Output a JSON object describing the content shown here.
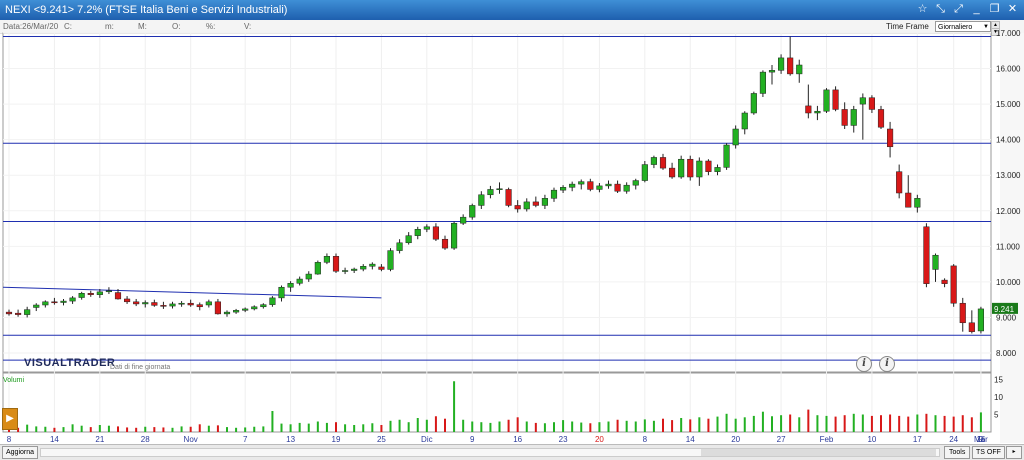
{
  "window": {
    "title": "NEXI <9.241> 7.2%  (FTSE Italia Beni e Servizi Industriali)"
  },
  "info_bar": {
    "date": "Data:26/Mar/20",
    "c": "C:",
    "m": "m:",
    "M": "M:",
    "o": "O:",
    "pct": "%:",
    "v": "V:"
  },
  "time_frame": {
    "label": "Time Frame",
    "value": "Giornaliero"
  },
  "brand": {
    "logo": "VISUALTRADER",
    "note": "Dati di fine giornata"
  },
  "volume_label": "Volumi",
  "buttons": {
    "aggiorna": "Aggiorna",
    "tools": "Tools",
    "ts_off": "TS OFF"
  },
  "colors": {
    "up": "#22b022",
    "down": "#d81818",
    "line": "#1f2fb0",
    "last_price_bg": "#1a7a1a"
  },
  "chart_data": [
    {
      "type": "candlestick",
      "ylim": [
        8.0,
        17.0
      ],
      "y_ticks": [
        "17.000",
        "16.000",
        "15.000",
        "14.000",
        "13.000",
        "12.000",
        "11.000",
        "10.000",
        "9.000",
        "8.000"
      ],
      "last_price_label": "9.241",
      "x_tick_labels": [
        "8",
        "14",
        "21",
        "28",
        "Nov",
        "7",
        "13",
        "19",
        "25",
        "Dic",
        "9",
        "16",
        "23",
        "20",
        "8",
        "14",
        "20",
        "27",
        "Feb",
        "10",
        "17",
        "24",
        "Mar",
        "9",
        "16"
      ],
      "horizontal_levels": [
        16.9,
        13.9,
        11.7,
        8.5,
        7.8
      ],
      "trendline": {
        "from": {
          "index": 0,
          "value": 9.85
        },
        "to": {
          "index": 41,
          "value": 9.55
        }
      },
      "ohlc": [
        [
          9.15,
          9.22,
          9.05,
          9.1
        ],
        [
          9.12,
          9.22,
          9.02,
          9.08
        ],
        [
          9.08,
          9.3,
          9.0,
          9.22
        ],
        [
          9.28,
          9.4,
          9.18,
          9.35
        ],
        [
          9.35,
          9.48,
          9.28,
          9.44
        ],
        [
          9.44,
          9.55,
          9.36,
          9.42
        ],
        [
          9.42,
          9.52,
          9.34,
          9.46
        ],
        [
          9.46,
          9.6,
          9.38,
          9.55
        ],
        [
          9.56,
          9.72,
          9.5,
          9.68
        ],
        [
          9.68,
          9.75,
          9.58,
          9.64
        ],
        [
          9.64,
          9.8,
          9.55,
          9.72
        ],
        [
          9.75,
          9.85,
          9.66,
          9.75
        ],
        [
          9.7,
          9.8,
          9.5,
          9.52
        ],
        [
          9.52,
          9.6,
          9.38,
          9.44
        ],
        [
          9.44,
          9.52,
          9.32,
          9.38
        ],
        [
          9.38,
          9.48,
          9.28,
          9.42
        ],
        [
          9.42,
          9.5,
          9.3,
          9.34
        ],
        [
          9.34,
          9.44,
          9.24,
          9.32
        ],
        [
          9.32,
          9.44,
          9.25,
          9.38
        ],
        [
          9.38,
          9.46,
          9.3,
          9.4
        ],
        [
          9.4,
          9.5,
          9.3,
          9.35
        ],
        [
          9.36,
          9.42,
          9.2,
          9.3
        ],
        [
          9.35,
          9.5,
          9.28,
          9.44
        ],
        [
          9.44,
          9.52,
          9.08,
          9.1
        ],
        [
          9.1,
          9.2,
          9.02,
          9.15
        ],
        [
          9.15,
          9.24,
          9.1,
          9.2
        ],
        [
          9.2,
          9.28,
          9.15,
          9.24
        ],
        [
          9.24,
          9.34,
          9.2,
          9.3
        ],
        [
          9.3,
          9.4,
          9.25,
          9.36
        ],
        [
          9.36,
          9.6,
          9.3,
          9.55
        ],
        [
          9.55,
          9.9,
          9.45,
          9.85
        ],
        [
          9.85,
          10.02,
          9.72,
          9.96
        ],
        [
          9.96,
          10.15,
          9.9,
          10.08
        ],
        [
          10.08,
          10.3,
          10.0,
          10.22
        ],
        [
          10.22,
          10.6,
          10.2,
          10.55
        ],
        [
          10.55,
          10.8,
          10.5,
          10.72
        ],
        [
          10.72,
          10.8,
          10.25,
          10.3
        ],
        [
          10.3,
          10.4,
          10.22,
          10.32
        ],
        [
          10.32,
          10.4,
          10.25,
          10.36
        ],
        [
          10.36,
          10.5,
          10.3,
          10.44
        ],
        [
          10.44,
          10.55,
          10.35,
          10.5
        ],
        [
          10.42,
          10.5,
          10.3,
          10.35
        ],
        [
          10.35,
          10.95,
          10.3,
          10.88
        ],
        [
          10.88,
          11.2,
          10.8,
          11.1
        ],
        [
          11.1,
          11.4,
          11.05,
          11.3
        ],
        [
          11.3,
          11.55,
          11.2,
          11.48
        ],
        [
          11.48,
          11.62,
          11.4,
          11.55
        ],
        [
          11.55,
          11.65,
          11.15,
          11.2
        ],
        [
          11.2,
          11.3,
          10.9,
          10.95
        ],
        [
          10.95,
          11.7,
          10.9,
          11.65
        ],
        [
          11.65,
          11.9,
          11.6,
          11.82
        ],
        [
          11.82,
          12.2,
          11.75,
          12.15
        ],
        [
          12.15,
          12.55,
          12.05,
          12.45
        ],
        [
          12.45,
          12.7,
          12.35,
          12.6
        ],
        [
          12.6,
          12.8,
          12.48,
          12.62
        ],
        [
          12.6,
          12.65,
          12.1,
          12.15
        ],
        [
          12.15,
          12.3,
          11.95,
          12.05
        ],
        [
          12.05,
          12.35,
          11.98,
          12.25
        ],
        [
          12.25,
          12.4,
          12.1,
          12.15
        ],
        [
          12.15,
          12.45,
          12.05,
          12.35
        ],
        [
          12.35,
          12.65,
          12.25,
          12.58
        ],
        [
          12.58,
          12.72,
          12.5,
          12.66
        ],
        [
          12.66,
          12.82,
          12.55,
          12.75
        ],
        [
          12.75,
          12.88,
          12.6,
          12.82
        ],
        [
          12.82,
          12.9,
          12.55,
          12.6
        ],
        [
          12.6,
          12.78,
          12.52,
          12.7
        ],
        [
          12.7,
          12.85,
          12.62,
          12.75
        ],
        [
          12.75,
          12.85,
          12.5,
          12.55
        ],
        [
          12.55,
          12.8,
          12.48,
          12.72
        ],
        [
          12.72,
          12.9,
          12.6,
          12.85
        ],
        [
          12.85,
          13.4,
          12.8,
          13.3
        ],
        [
          13.3,
          13.55,
          13.2,
          13.5
        ],
        [
          13.5,
          13.6,
          13.15,
          13.2
        ],
        [
          13.2,
          13.35,
          12.9,
          12.95
        ],
        [
          12.95,
          13.55,
          12.9,
          13.45
        ],
        [
          13.45,
          13.55,
          12.85,
          12.95
        ],
        [
          12.95,
          13.5,
          12.7,
          13.4
        ],
        [
          13.4,
          13.45,
          13.0,
          13.1
        ],
        [
          13.1,
          13.3,
          13.0,
          13.22
        ],
        [
          13.22,
          13.9,
          13.15,
          13.85
        ],
        [
          13.85,
          14.4,
          13.75,
          14.3
        ],
        [
          14.3,
          14.8,
          14.15,
          14.75
        ],
        [
          14.75,
          15.35,
          14.7,
          15.3
        ],
        [
          15.3,
          15.95,
          15.2,
          15.9
        ],
        [
          15.9,
          16.1,
          15.55,
          15.95
        ],
        [
          15.95,
          16.4,
          15.85,
          16.3
        ],
        [
          16.3,
          16.9,
          15.8,
          15.85
        ],
        [
          15.85,
          16.25,
          15.6,
          16.1
        ],
        [
          14.95,
          15.55,
          14.6,
          14.75
        ],
        [
          14.75,
          14.95,
          14.55,
          14.8
        ],
        [
          14.8,
          15.45,
          14.75,
          15.4
        ],
        [
          15.4,
          15.5,
          14.8,
          14.85
        ],
        [
          14.85,
          15.05,
          14.3,
          14.4
        ],
        [
          14.4,
          14.95,
          14.2,
          14.85
        ],
        [
          15.0,
          15.3,
          14.0,
          15.18
        ],
        [
          15.18,
          15.25,
          14.75,
          14.85
        ],
        [
          14.85,
          14.95,
          14.3,
          14.35
        ],
        [
          14.3,
          14.5,
          13.5,
          13.8
        ],
        [
          13.1,
          13.3,
          12.35,
          12.5
        ],
        [
          12.5,
          13.0,
          12.1,
          12.1
        ],
        [
          12.1,
          12.45,
          11.95,
          12.35
        ],
        [
          11.55,
          11.65,
          9.85,
          9.95
        ],
        [
          10.35,
          10.8,
          10.0,
          10.75
        ],
        [
          10.05,
          10.1,
          9.85,
          9.95
        ],
        [
          10.45,
          10.5,
          9.3,
          9.4
        ],
        [
          9.4,
          9.55,
          8.6,
          8.85
        ],
        [
          8.85,
          9.2,
          8.55,
          8.6
        ],
        [
          8.62,
          9.3,
          8.55,
          9.24
        ]
      ],
      "volumes": [
        1.3,
        1.2,
        2.1,
        1.6,
        1.5,
        1.2,
        1.4,
        2.2,
        1.8,
        1.4,
        2.0,
        1.8,
        1.6,
        1.3,
        1.2,
        1.5,
        1.4,
        1.3,
        1.2,
        1.6,
        1.5,
        2.2,
        1.8,
        1.9,
        1.4,
        1.2,
        1.3,
        1.5,
        1.6,
        6.0,
        2.4,
        2.2,
        2.6,
        2.4,
        3.0,
        2.6,
        2.8,
        2.2,
        2.0,
        2.2,
        2.5,
        2.0,
        3.2,
        3.5,
        2.8,
        4.0,
        3.5,
        4.5,
        3.8,
        14.5,
        3.5,
        3.0,
        2.8,
        2.6,
        3.0,
        3.5,
        4.2,
        3.0,
        2.6,
        2.5,
        2.8,
        3.4,
        3.0,
        2.7,
        2.5,
        2.8,
        3.0,
        3.5,
        3.2,
        3.0,
        3.6,
        3.2,
        3.8,
        3.4,
        4.0,
        3.6,
        4.2,
        3.8,
        4.4,
        5.2,
        3.8,
        4.2,
        4.6,
        5.8,
        4.5,
        4.8,
        5.0,
        4.2,
        6.4,
        4.8,
        4.6,
        4.4,
        4.8,
        5.2,
        5.0,
        4.6,
        4.8,
        5.0,
        4.6,
        4.4,
        5.0,
        5.2,
        4.8,
        4.6,
        4.4,
        4.8,
        4.2,
        5.6
      ],
      "volume_ticks": [
        "15",
        "10",
        "5"
      ]
    }
  ]
}
